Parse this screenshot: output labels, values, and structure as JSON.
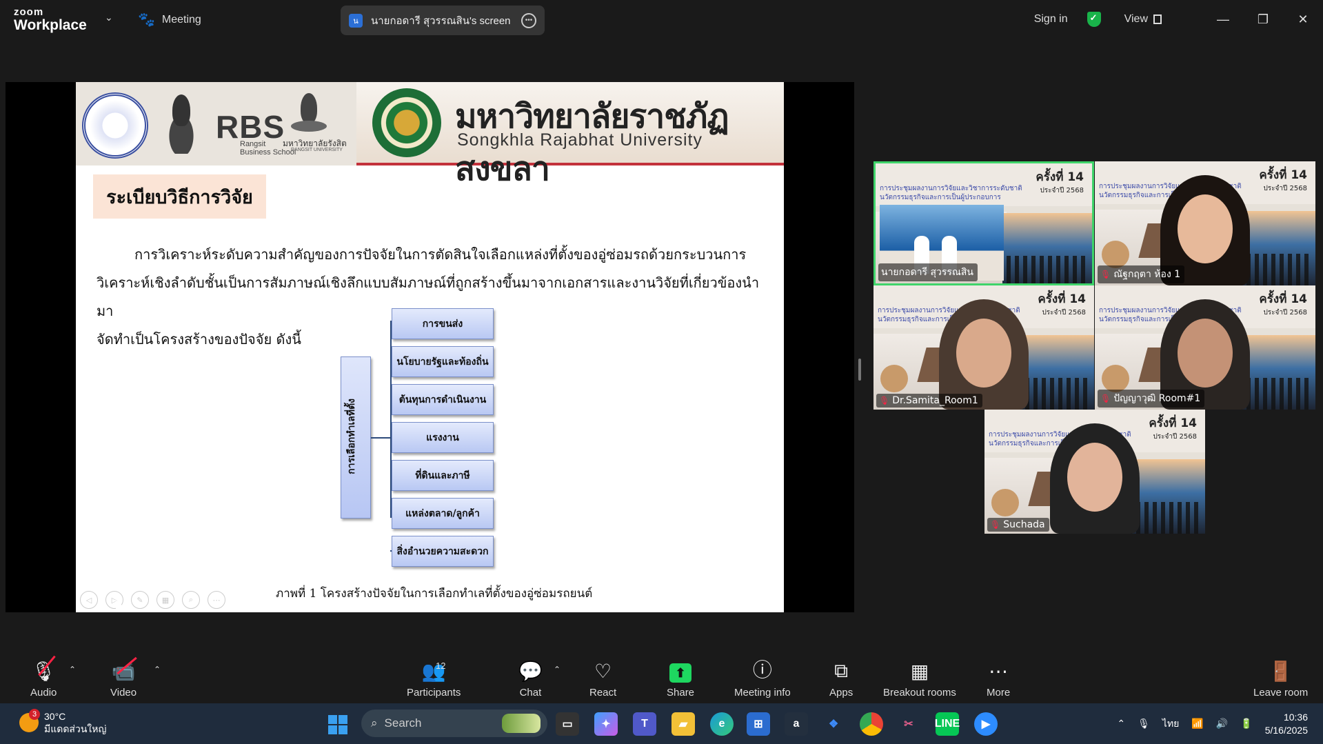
{
  "titlebar": {
    "brand_top": "zoom",
    "brand_bottom": "Workplace",
    "meeting_label": "Meeting",
    "screen_share_label": "นายกอดารี สุวรรณสิน's screen",
    "screen_share_avatar": "น",
    "signin": "Sign in",
    "view": "View",
    "minimize": "—",
    "restore": "❐",
    "close": "✕"
  },
  "slide": {
    "university_thai": "มหาวิทยาลัยราชภัฏสงขลา",
    "university_en": "Songkhla Rajabhat University",
    "rbs": "RBS",
    "rbs_sub1": "Rangsit",
    "rbs_sub2": "Business School",
    "rangsit_thai": "มหาวิทยาลัยรังสิต",
    "rangsit_en": "RANGSIT UNIVERSITY",
    "section_title": "ระเบียบวิธีการวิจัย",
    "para_line1": "การวิเคราะห์ระดับความสำคัญของการปัจจัยในการตัดสินใจเลือกแหล่งที่ตั้งของอู่ซ่อมรถด้วยกระบวนการ",
    "para_line2": "วิเคราะห์เชิงลำดับชั้นเป็นการสัมภาษณ์เชิงลึกแบบสัมภาษณ์ที่ถูกสร้างขึ้นมาจากเอกสารและงานวิจัยที่เกี่ยวข้องนำมา",
    "para_line3": "จัดทำเป็นโครงสร้างของปัจจัย ดังนี้",
    "diagram_root": "การเลือกทำเลที่ตั้ง",
    "diagram_items": [
      "การขนส่ง",
      "นโยบายรัฐและท้องถิ่น",
      "ต้นทุนการดำเนินงาน",
      "แรงงาน",
      "ที่ดินและภาษี",
      "แหล่งตลาด/ลูกค้า",
      "สิ่งอำนวยความสะดวก"
    ],
    "caption": "ภาพที่ 1 โครงสร้างปัจจัยในการเลือกทำเลที่ตั้งของอู่ซ่อมรถยนต์"
  },
  "tiles": {
    "banner_line1": "การประชุมผลงานการวิจัยและวิชาการระดับชาติ",
    "banner_line2": "นวัตกรรมธุรกิจและการเป็นผู้ประกอบการ",
    "badge_main": "ครั้งที่ 14",
    "badge_sub": "ประจำปี 2568",
    "participants": [
      {
        "name": "นายกอดารี สุวรรณสิน",
        "muted": false
      },
      {
        "name": "ณัฐกฤตา ห้อง 1",
        "muted": true
      },
      {
        "name": "Dr.Samita_Room1",
        "muted": true
      },
      {
        "name": "ปัญญาวุฒิ Room#1",
        "muted": true
      },
      {
        "name": "Suchada",
        "muted": true
      }
    ]
  },
  "toolbar": {
    "audio": "Audio",
    "video": "Video",
    "participants": "Participants",
    "participants_count": "12",
    "chat": "Chat",
    "react": "React",
    "share": "Share",
    "meeting_info": "Meeting info",
    "apps": "Apps",
    "breakout": "Breakout rooms",
    "more": "More",
    "leave": "Leave room"
  },
  "taskbar": {
    "weather_badge": "3",
    "temp": "30°C",
    "weather_desc": "มีแดดส่วนใหญ่",
    "search": "Search",
    "lang": "ไทย",
    "time": "10:36",
    "date": "5/16/2025"
  },
  "colors": {
    "active_speaker": "#3fd46a",
    "share_green": "#1ed760",
    "muted_red": "#ff2244"
  }
}
